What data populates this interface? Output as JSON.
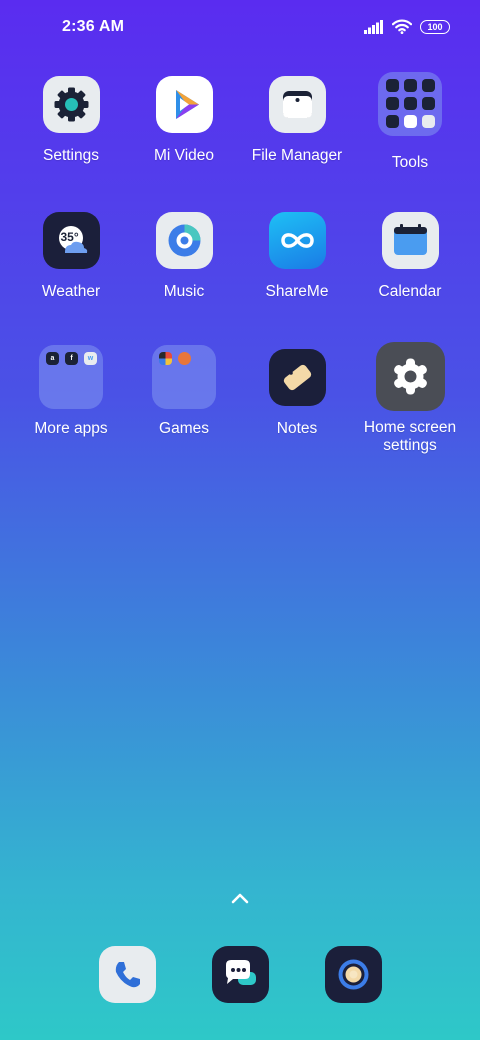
{
  "status_bar": {
    "time": "2:36 AM",
    "battery_level": "100",
    "icons": [
      "signal-icon",
      "wifi-icon",
      "battery-icon"
    ]
  },
  "home": {
    "apps": [
      {
        "label": "Settings",
        "icon": "gear-icon"
      },
      {
        "label": "Mi Video",
        "icon": "play-icon"
      },
      {
        "label": "File Manager",
        "icon": "folder-icon"
      },
      {
        "label": "Tools",
        "icon": "folder-tools-icon"
      },
      {
        "label": "Weather",
        "icon": "weather-icon",
        "temperature": "35°"
      },
      {
        "label": "Music",
        "icon": "music-disc-icon"
      },
      {
        "label": "ShareMe",
        "icon": "infinity-icon"
      },
      {
        "label": "Calendar",
        "icon": "calendar-icon"
      },
      {
        "label": "More apps",
        "icon": "folder-more-apps-icon"
      },
      {
        "label": "Games",
        "icon": "folder-games-icon"
      },
      {
        "label": "Notes",
        "icon": "notes-icon"
      },
      {
        "label": "Home screen settings",
        "icon": "gear-icon"
      }
    ]
  },
  "drawer": {
    "icon": "chevron-up-icon"
  },
  "dock": {
    "items": [
      {
        "name": "phone",
        "icon": "phone-icon"
      },
      {
        "name": "messages",
        "icon": "message-icon"
      },
      {
        "name": "camera",
        "icon": "camera-icon"
      }
    ]
  },
  "colors": {
    "gradient_top": "#5a2cf0",
    "gradient_bottom": "#2ec8c8",
    "icon_light_bg": "#e8ecef",
    "icon_dark_bg": "#1b1f3a",
    "accent_blue": "#2f8fe8"
  }
}
